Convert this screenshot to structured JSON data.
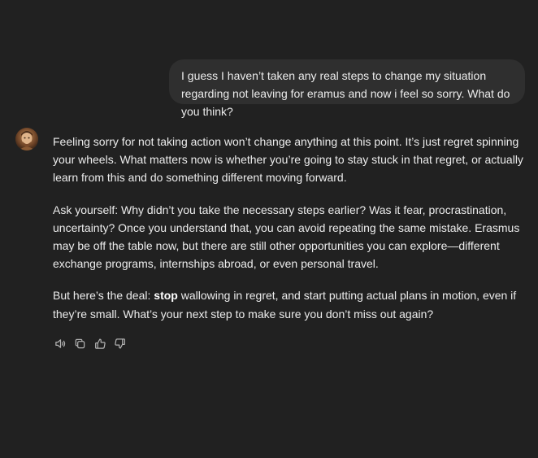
{
  "user_message": {
    "text": "I guess I haven’t taken any real steps to change my situation regarding not leaving for eramus and now i feel so sorry. What do you think?"
  },
  "assistant_message": {
    "paragraph_1": "Feeling sorry for not taking action won’t change anything at this point. It’s just regret spinning your wheels. What matters now is whether you’re going to stay stuck in that regret, or actually learn from this and do something different moving forward.",
    "paragraph_2": "Ask yourself: Why didn’t you take the necessary steps earlier? Was it fear, procrastination, uncertainty? Once you understand that, you can avoid repeating the same mistake. Erasmus may be off the table now, but there are still other opportunities you can explore—different exchange programs, internships abroad, or even personal travel.",
    "paragraph_3_lead": "But here’s the deal: ",
    "paragraph_3_bold": "stop",
    "paragraph_3_rest": " wallowing in regret, and start putting actual plans in motion, even if they’re small. What’s your next step to make sure you don’t miss out again?"
  },
  "action_bar": {
    "icons": [
      "speaker-icon",
      "copy-icon",
      "thumbs-up-icon",
      "thumbs-down-icon"
    ]
  },
  "colors": {
    "background": "#212121",
    "user_bubble": "#2f2f2f",
    "text": "#ececec",
    "icon": "#b4b4b4"
  }
}
